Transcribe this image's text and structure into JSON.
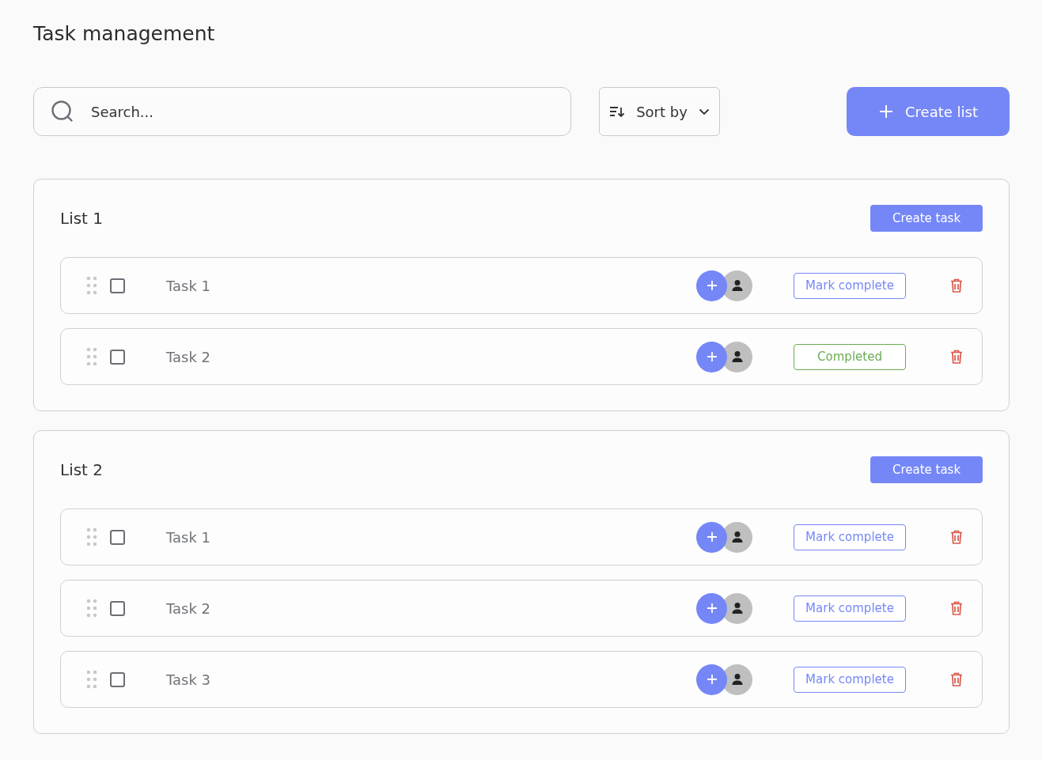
{
  "title": "Task management",
  "search": {
    "placeholder": "Search..."
  },
  "sort": {
    "label": "Sort by"
  },
  "create_list": {
    "label": "Create list"
  },
  "lists": [
    {
      "name": "List 1",
      "create_task": "Create task",
      "tasks": [
        {
          "name": "Task 1",
          "checked": false,
          "completed": false,
          "status": "Mark complete"
        },
        {
          "name": "Task 2",
          "checked": false,
          "completed": true,
          "status": "Completed"
        }
      ]
    },
    {
      "name": "List 2",
      "create_task": "Create task",
      "tasks": [
        {
          "name": "Task 1",
          "checked": false,
          "completed": false,
          "status": "Mark complete"
        },
        {
          "name": "Task 2",
          "checked": false,
          "completed": false,
          "status": "Mark complete"
        },
        {
          "name": "Task 3",
          "checked": false,
          "completed": false,
          "status": "Mark complete"
        }
      ]
    }
  ]
}
